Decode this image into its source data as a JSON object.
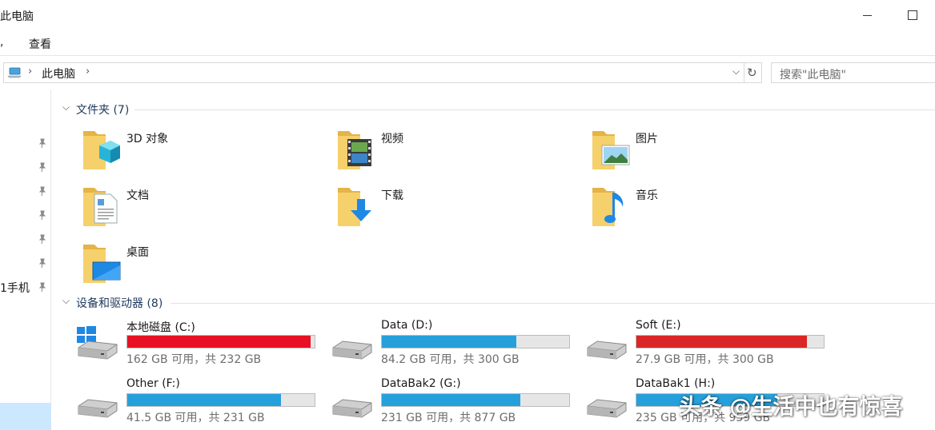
{
  "window": {
    "title": "此电脑"
  },
  "ribbon": {
    "fragment": ",",
    "view": "查看"
  },
  "address": {
    "crumb": "此电脑"
  },
  "search": {
    "placeholder": "搜索\"此电脑\""
  },
  "sidebar": {
    "label": "1手机"
  },
  "folders_section": {
    "label": "文件夹 (7)",
    "items": [
      {
        "name": "3D 对象",
        "icon": "3d-objects-folder-icon"
      },
      {
        "name": "视频",
        "icon": "videos-folder-icon"
      },
      {
        "name": "图片",
        "icon": "pictures-folder-icon"
      },
      {
        "name": "文档",
        "icon": "documents-folder-icon"
      },
      {
        "name": "下载",
        "icon": "downloads-folder-icon"
      },
      {
        "name": "音乐",
        "icon": "music-folder-icon"
      },
      {
        "name": "桌面",
        "icon": "desktop-folder-icon"
      }
    ]
  },
  "drives_section": {
    "label": "设备和驱动器 (8)",
    "items": [
      {
        "name": "本地磁盘 (C:)",
        "info": "162 GB 可用，共 232 GB",
        "used_fraction": 0.98,
        "color": "#e81123",
        "icon": "windows-drive-icon"
      },
      {
        "name": "Data (D:)",
        "info": "84.2 GB 可用，共 300 GB",
        "used_fraction": 0.72,
        "color": "#26a0da",
        "icon": "drive-icon"
      },
      {
        "name": "Soft (E:)",
        "info": "27.9 GB 可用，共 300 GB",
        "used_fraction": 0.91,
        "color": "#da2626",
        "icon": "drive-icon"
      },
      {
        "name": "Other (F:)",
        "info": "41.5 GB 可用，共 231 GB",
        "used_fraction": 0.82,
        "color": "#26a0da",
        "icon": "drive-icon"
      },
      {
        "name": "DataBak2 (G:)",
        "info": "231 GB 可用，共 877 GB",
        "used_fraction": 0.74,
        "color": "#26a0da",
        "icon": "drive-icon"
      },
      {
        "name": "DataBak1 (H:)",
        "info": "235 GB 可用，共 959 GB",
        "used_fraction": 0.75,
        "color": "#26a0da",
        "icon": "drive-icon"
      }
    ]
  },
  "watermark": "头条 @生活中也有惊喜",
  "colors": {
    "accent": "#26a0da",
    "warning": "#e81123",
    "folder": "#f3c85a",
    "selection": "#cce8ff"
  }
}
